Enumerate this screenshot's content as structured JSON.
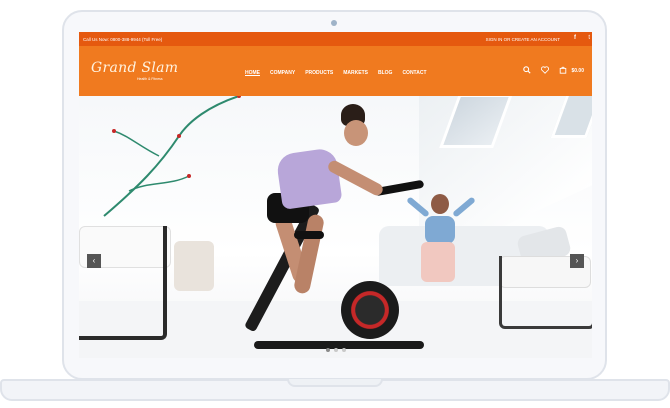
{
  "topbar": {
    "phone_text": "Call Us Now: 0800-388-9944 (Toll Free)",
    "account_text": "SIGN IN OR CREATE AN ACCOUNT",
    "social_icons": [
      "facebook-icon",
      "twitter-icon"
    ]
  },
  "header": {
    "logo_text": "Grand Slam",
    "logo_tagline": "Health & Fitness",
    "nav": [
      "HOME",
      "COMPANY",
      "PRODUCTS",
      "MARKETS",
      "BLOG",
      "CONTACT"
    ],
    "active_nav": "HOME",
    "cart_total": "$0.00"
  },
  "slider": {
    "prev_label": "‹",
    "next_label": "›",
    "slide_count": 3,
    "active_slide": 1
  },
  "colors": {
    "topbar": "#e5590f",
    "header": "#f07a1f",
    "bike_accent": "#c62828"
  }
}
